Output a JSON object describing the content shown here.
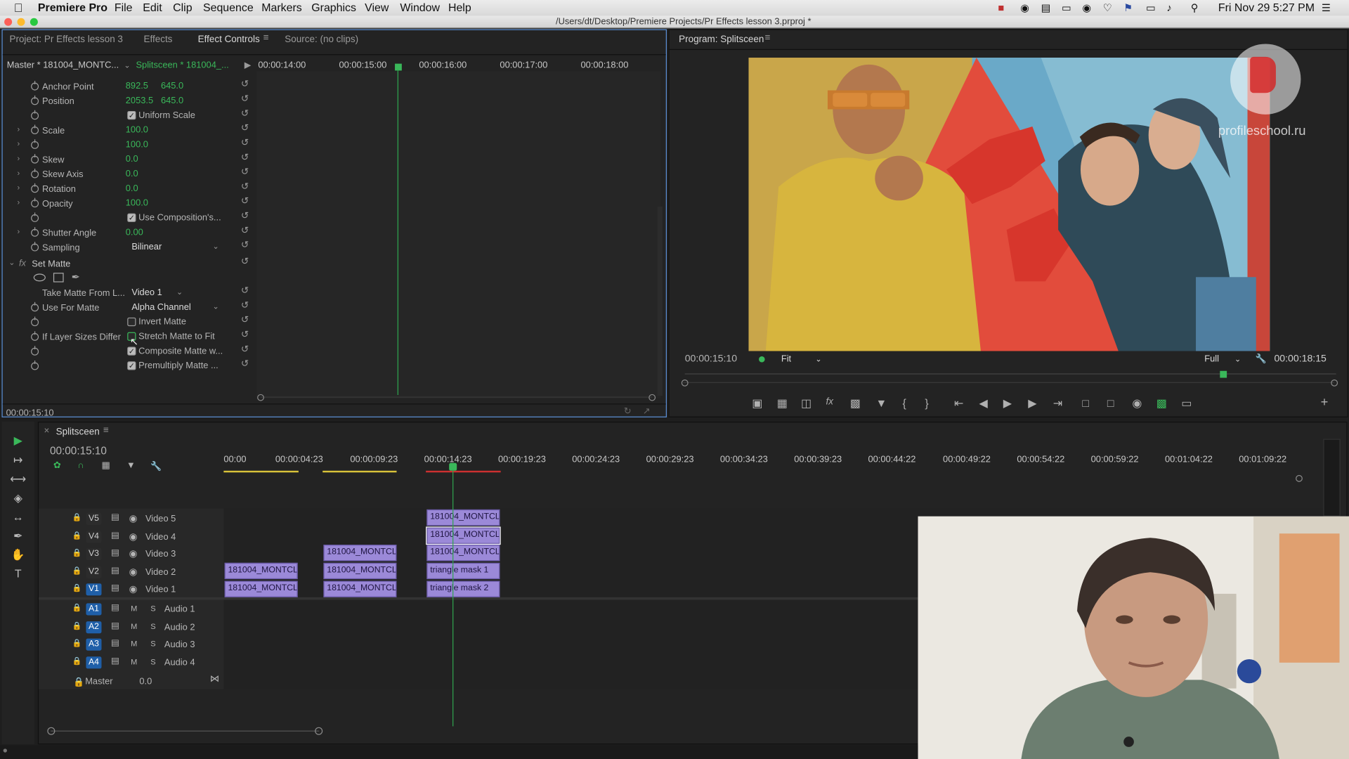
{
  "menubar": {
    "apple": "",
    "app_name": "Premiere Pro",
    "items": [
      "File",
      "Edit",
      "Clip",
      "Sequence",
      "Markers",
      "Graphics",
      "View",
      "Window",
      "Help"
    ],
    "clock": "Fri Nov 29  5:27 PM"
  },
  "titlebar": {
    "path": "/Users/dt/Desktop/Premiere Projects/Pr Effects lesson 3.prproj *"
  },
  "left_tabs": [
    "Project: Pr Effects lesson 3",
    "Effects",
    "Effect Controls",
    "Source: (no clips)"
  ],
  "effect_controls": {
    "master_label": "Master * 181004_MONTC...",
    "seq_label": "Splitsceen * 181004_...",
    "timecodes": [
      "00:00:14:00",
      "00:00:15:00",
      "00:00:16:00",
      "00:00:17:00",
      "00:00:18:00"
    ],
    "props": [
      {
        "label": "Anchor Point",
        "v1": "892.5",
        "v2": "645.0"
      },
      {
        "label": "Position",
        "v1": "2053.5",
        "v2": "645.0"
      },
      {
        "label": "",
        "check": "Uniform Scale"
      },
      {
        "label": "Scale",
        "v1": "100.0"
      },
      {
        "label": "",
        "v1": "100.0"
      },
      {
        "label": "Skew",
        "v1": "0.0"
      },
      {
        "label": "Skew Axis",
        "v1": "0.0"
      },
      {
        "label": "Rotation",
        "v1": "0.0"
      },
      {
        "label": "Opacity",
        "v1": "100.0"
      },
      {
        "label": "",
        "check": "Use Composition's..."
      },
      {
        "label": "Shutter Angle",
        "v1": "0.00"
      },
      {
        "label": "Sampling",
        "dropdown": "Bilinear"
      }
    ],
    "set_matte": "Set Matte",
    "matte_props": [
      {
        "label": "Take Matte From L...",
        "dropdown": "Video 1"
      },
      {
        "label": "Use For Matte",
        "dropdown": "Alpha Channel"
      },
      {
        "label": "",
        "check": "Invert Matte"
      },
      {
        "label": "If Layer Sizes Differ",
        "check": "Stretch Matte to Fit"
      },
      {
        "label": "",
        "check": "Composite Matte w..."
      },
      {
        "label": "",
        "check": "Premultiply Matte ..."
      }
    ],
    "fx_label": "fx",
    "current_time": "00:00:15:10"
  },
  "program": {
    "title": "Program: Splitsceen",
    "timecode": "00:00:15:10",
    "fit": "Fit",
    "quality": "Full",
    "duration": "00:00:18:15",
    "watermark": "profileschool.ru"
  },
  "timeline": {
    "seq_name": "Splitsceen",
    "timecode": "00:00:15:10",
    "ruler": [
      "00:00",
      "00:00:04:23",
      "00:00:09:23",
      "00:00:14:23",
      "00:00:19:23",
      "00:00:24:23",
      "00:00:29:23",
      "00:00:34:23",
      "00:00:39:23",
      "00:00:44:22",
      "00:00:49:22",
      "00:00:54:22",
      "00:00:59:22",
      "00:01:04:22",
      "00:01:09:22"
    ],
    "video_tracks": [
      {
        "id": "V5",
        "name": "Video 5"
      },
      {
        "id": "V4",
        "name": "Video 4"
      },
      {
        "id": "V3",
        "name": "Video 3"
      },
      {
        "id": "V2",
        "name": "Video 2"
      },
      {
        "id": "V1",
        "name": "Video 1"
      }
    ],
    "audio_tracks": [
      {
        "id": "A1",
        "name": "Audio 1"
      },
      {
        "id": "A2",
        "name": "Audio 2"
      },
      {
        "id": "A3",
        "name": "Audio 3"
      },
      {
        "id": "A4",
        "name": "Audio 4"
      }
    ],
    "master": {
      "label": "Master",
      "value": "0.0"
    },
    "clips": {
      "v5_c": "181004_MONTCL",
      "v4_c": "181004_MONTCL",
      "v3_b": "181004_MONTCL",
      "v3_c": "181004_MONTCL",
      "v2_a": "181004_MONTCL",
      "v2_b": "181004_MONTCL",
      "v2_c": "triangle mask 1",
      "v1_a": "181004_MONTCL",
      "v1_b": "181004_MONTCL",
      "v1_c": "triangle mask 2"
    }
  },
  "colors": {
    "accent": "#4a90e2",
    "timecode": "#3ab85a",
    "clip": "#9b89d8"
  }
}
